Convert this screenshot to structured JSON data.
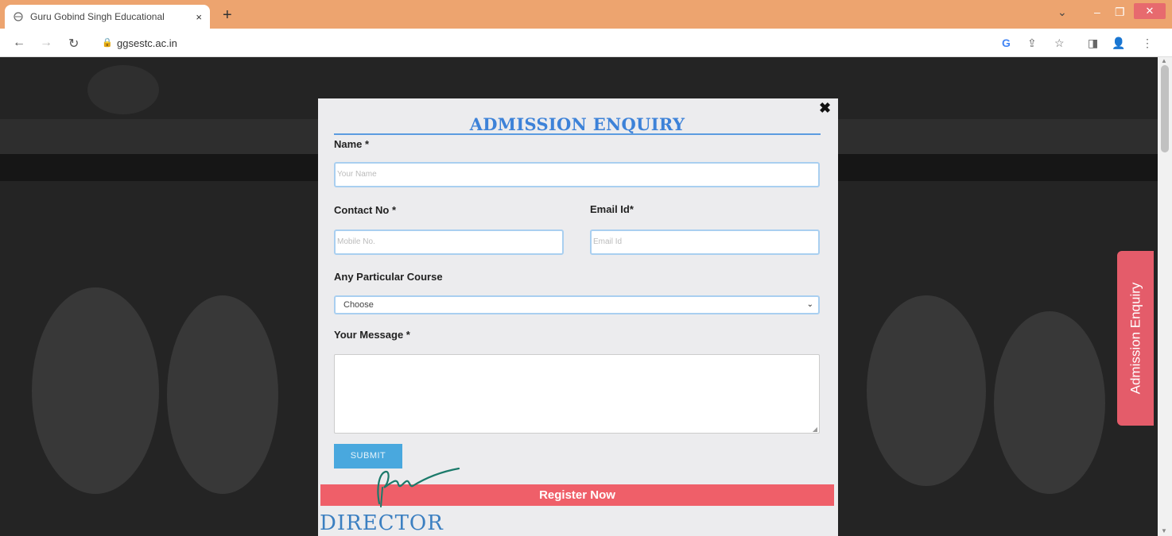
{
  "browser": {
    "tab_title": "Guru Gobind Singh Educational",
    "tab_close": "×",
    "new_tab": "+",
    "url": "ggsestc.ac.in"
  },
  "modal": {
    "title": "ADMISSION ENQUIRY",
    "close_glyph": "✖",
    "name_label": "Name *",
    "name_placeholder": "Your Name",
    "contact_label": "Contact No *",
    "contact_placeholder": "Mobile No.",
    "email_label": "Email Id*",
    "email_placeholder": "Email Id",
    "course_label": "Any Particular Course",
    "course_selected": "Choose",
    "message_label": "Your Message *",
    "submit_label": "SUBMIT",
    "register_label": "Register Now",
    "stamp_text": "DIRECTOR"
  },
  "side_tab": {
    "label": "Admission Enquiry"
  },
  "colors": {
    "tab_strip": "#eda46f",
    "title_blue": "#3d82d8",
    "register_bar": "#ef5f69",
    "side_tab": "#e45c6a",
    "submit": "#49a8de"
  }
}
